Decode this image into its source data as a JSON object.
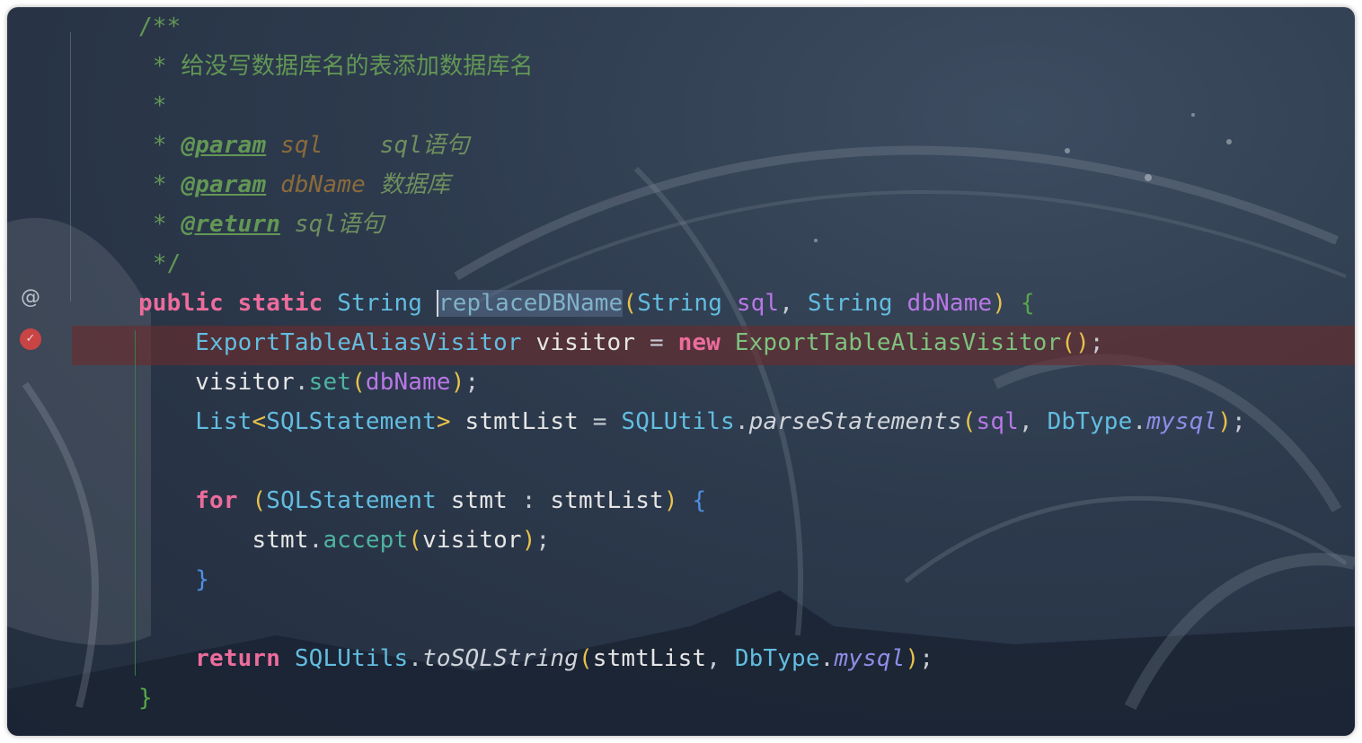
{
  "editor": {
    "comment_lines": [
      "/**",
      "* 给没写数据库名的表添加数据库名",
      "*",
      "*/"
    ],
    "javadoc": {
      "star": "*",
      "param_tag": "@param",
      "return_tag": "@return",
      "param1_name": "sql",
      "param1_desc": "sql语句",
      "param2_name": "dbName",
      "param2_desc": "数据库",
      "return_desc": "sql语句"
    },
    "gutter": {
      "override_icon": "at-sign-icon",
      "override_glyph": "@",
      "breakpoint_icon": "breakpoint-icon",
      "breakpoint_glyph": "✓"
    },
    "tokens": {
      "public": "public",
      "static": "static",
      "String": "String",
      "method_name": "replaceDBName",
      "sql": "sql",
      "dbName": "dbName",
      "ExportTableAliasVisitor": "ExportTableAliasVisitor",
      "visitor": "visitor",
      "new": "new",
      "set": "set",
      "List": "List",
      "SQLStatement": "SQLStatement",
      "stmtList": "stmtList",
      "SQLUtils": "SQLUtils",
      "parseStatements": "parseStatements",
      "DbType": "DbType",
      "mysql": "mysql",
      "for": "for",
      "stmt": "stmt",
      "accept": "accept",
      "return": "return",
      "toSQLString": "toSQLString"
    }
  }
}
